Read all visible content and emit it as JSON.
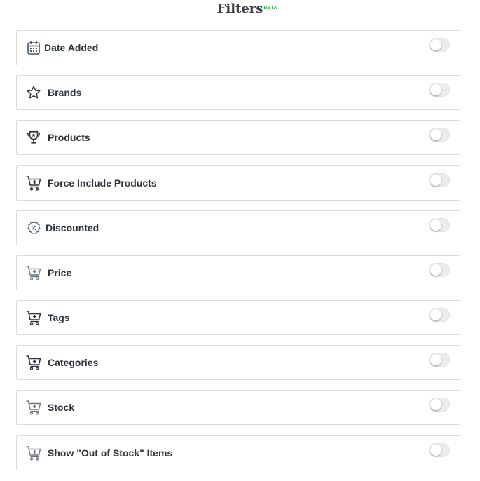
{
  "header": {
    "title": "Filters",
    "badge": "BETA"
  },
  "filters": [
    {
      "label": "Date Added",
      "icon": "calendar-icon",
      "enabled": false
    },
    {
      "label": "Brands",
      "icon": "star-icon",
      "enabled": false
    },
    {
      "label": "Products",
      "icon": "trophy-icon",
      "enabled": false
    },
    {
      "label": "Force Include Products",
      "icon": "cart-plus-icon",
      "enabled": false
    },
    {
      "label": "Discounted",
      "icon": "discount-badge-icon",
      "enabled": false
    },
    {
      "label": "Price",
      "icon": "cart-plus-icon",
      "enabled": false
    },
    {
      "label": "Tags",
      "icon": "cart-plus-icon",
      "enabled": false
    },
    {
      "label": "Categories",
      "icon": "cart-plus-icon",
      "enabled": false
    },
    {
      "label": "Stock",
      "icon": "cart-plus-icon",
      "enabled": false
    },
    {
      "label": "Show \"Out of Stock\" Items",
      "icon": "cart-plus-icon",
      "enabled": false
    }
  ]
}
